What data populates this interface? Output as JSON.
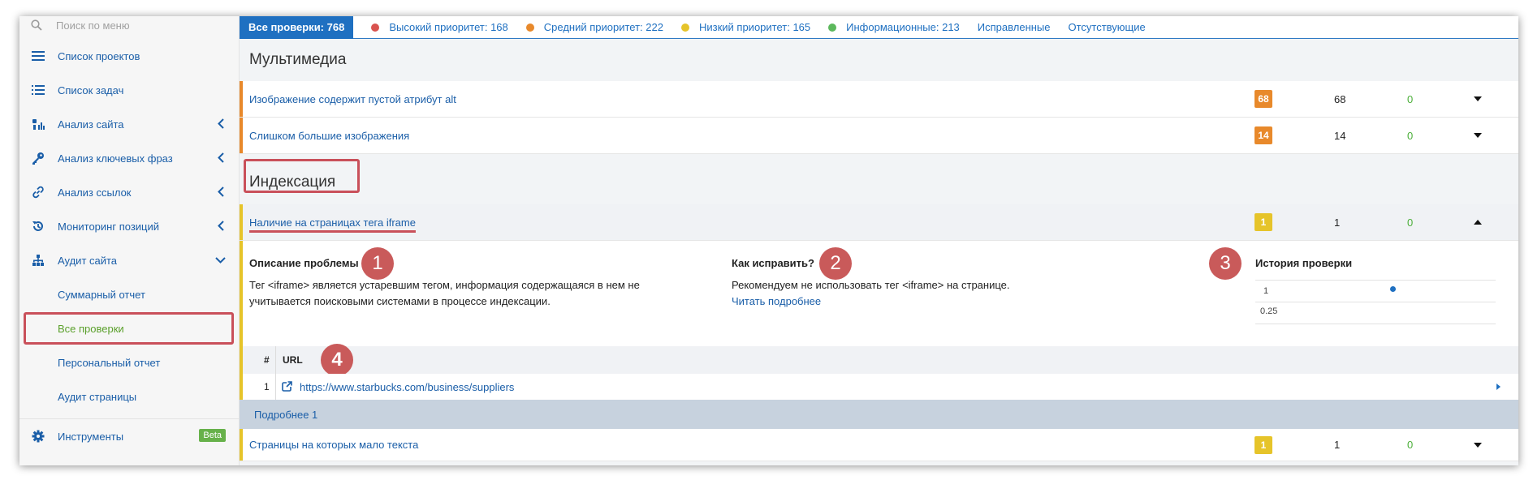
{
  "sidebar": {
    "search_placeholder": "Поиск по меню",
    "items": [
      {
        "label": "Список проектов"
      },
      {
        "label": "Список задач"
      },
      {
        "label": "Анализ сайта"
      },
      {
        "label": "Анализ ключевых фраз"
      },
      {
        "label": "Анализ ссылок"
      },
      {
        "label": "Мониторинг позиций"
      },
      {
        "label": "Аудит сайта"
      }
    ],
    "sub_items": [
      {
        "label": "Суммарный отчет"
      },
      {
        "label": "Все проверки"
      },
      {
        "label": "Персональный отчет"
      },
      {
        "label": "Аудит страницы"
      }
    ],
    "tools": {
      "label": "Инструменты",
      "badge": "Beta"
    }
  },
  "topbar": {
    "all": "Все проверки: 768",
    "high": "Высокий приоритет: 168",
    "medium": "Средний приоритет: 222",
    "low": "Низкий приоритет: 165",
    "info": "Информационные: 213",
    "fixed": "Исправленные",
    "missing": "Отсутствующие"
  },
  "colors": {
    "high": "#d9534f",
    "medium": "#e8892b",
    "low": "#e6c42a",
    "info": "#5cb85c",
    "accent": "#1f70c1"
  },
  "multimedia": {
    "title": "Мультимедиа",
    "rows": [
      {
        "title": "Изображение содержит пустой атрибут alt",
        "badge": "68",
        "count": "68",
        "fixed": "0"
      },
      {
        "title": "Слишком большие изображения",
        "badge": "14",
        "count": "14",
        "fixed": "0"
      }
    ]
  },
  "indexing": {
    "title": "Индексация",
    "expanded_row": {
      "title": "Наличие на страницах тега iframe",
      "badge": "1",
      "count": "1",
      "fixed": "0"
    },
    "details": {
      "problem_heading": "Описание проблемы",
      "problem_text_1": "Тег <iframe> является устаревшим тегом, информация содержащаяся в нем не",
      "problem_text_2": "учитывается поисковыми системами в процессе индексации.",
      "fix_heading": "Как исправить?",
      "fix_text": "Рекомендуем не использовать тег <iframe> на странице.",
      "fix_link": "Читать подробнее",
      "history_heading": "История проверки",
      "history_tick_1": "1",
      "history_tick_2": "0.25"
    },
    "markers": [
      "1",
      "2",
      "3",
      "4"
    ],
    "url_table": {
      "col_num": "#",
      "col_url": "URL",
      "rows": [
        {
          "num": "1",
          "url": "https://www.starbucks.com/business/suppliers"
        }
      ]
    },
    "more": "Подробнее 1",
    "next_row": {
      "title": "Страницы на которых мало текста",
      "badge": "1",
      "count": "1",
      "fixed": "0"
    }
  }
}
